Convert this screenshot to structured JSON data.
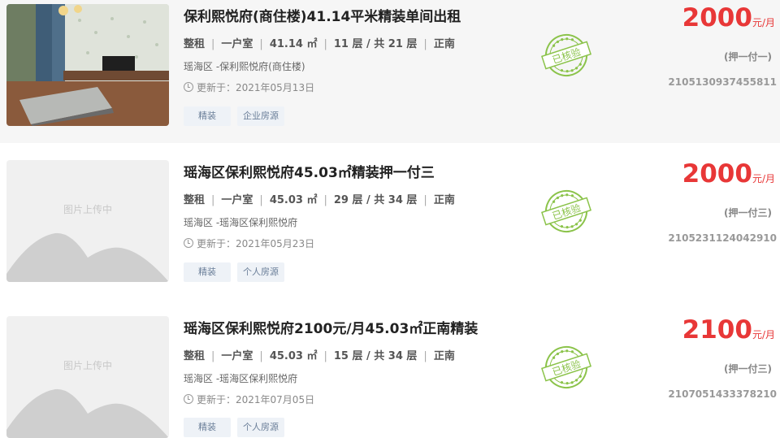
{
  "listings": [
    {
      "title": "保利熙悦府(商住楼)41.14平米精装单间出租",
      "rent_type": "整租",
      "layout": "一户室",
      "area": "41.14 ㎡",
      "floor": "11 层 / 共 21 层",
      "orientation": "正南",
      "address": "瑶海区 -保利熙悦府(商住楼)",
      "updated": "更新于：2021年05月13日",
      "tags": [
        "精装",
        "企业房源"
      ],
      "stamp": "已核验",
      "price": "2000",
      "price_unit": "元/月",
      "deposit": "(押一付一)",
      "code": "2105130937455811",
      "has_photo": true
    },
    {
      "title": "瑶海区保利熙悦府45.03㎡精装押一付三",
      "rent_type": "整租",
      "layout": "一户室",
      "area": "45.03 ㎡",
      "floor": "29 层 / 共 34 层",
      "orientation": "正南",
      "address": "瑶海区 -瑶海区保利熙悦府",
      "updated": "更新于：2021年05月23日",
      "tags": [
        "精装",
        "个人房源"
      ],
      "stamp": "已核验",
      "price": "2000",
      "price_unit": "元/月",
      "deposit": "(押一付三)",
      "code": "2105231124042910",
      "placeholder_text": "图片上传中",
      "has_photo": false
    },
    {
      "title": "瑶海区保利熙悦府2100元/月45.03㎡正南精装",
      "rent_type": "整租",
      "layout": "一户室",
      "area": "45.03 ㎡",
      "floor": "15 层 / 共 34 层",
      "orientation": "正南",
      "address": "瑶海区 -瑶海区保利熙悦府",
      "updated": "更新于：2021年07月05日",
      "tags": [
        "精装",
        "个人房源"
      ],
      "stamp": "已核验",
      "price": "2100",
      "price_unit": "元/月",
      "deposit": "(押一付三)",
      "code": "2107051433378210",
      "placeholder_text": "图片上传中",
      "has_photo": false
    }
  ],
  "colors": {
    "price": "#e83737",
    "stamp": "#8bc34a",
    "tag_bg": "#eef2f7",
    "row_highlight": "#f6f6f6"
  },
  "icons": {
    "clock": "clock-icon",
    "stamp": "verified-stamp-icon",
    "placeholder": "mountain-placeholder-icon"
  }
}
